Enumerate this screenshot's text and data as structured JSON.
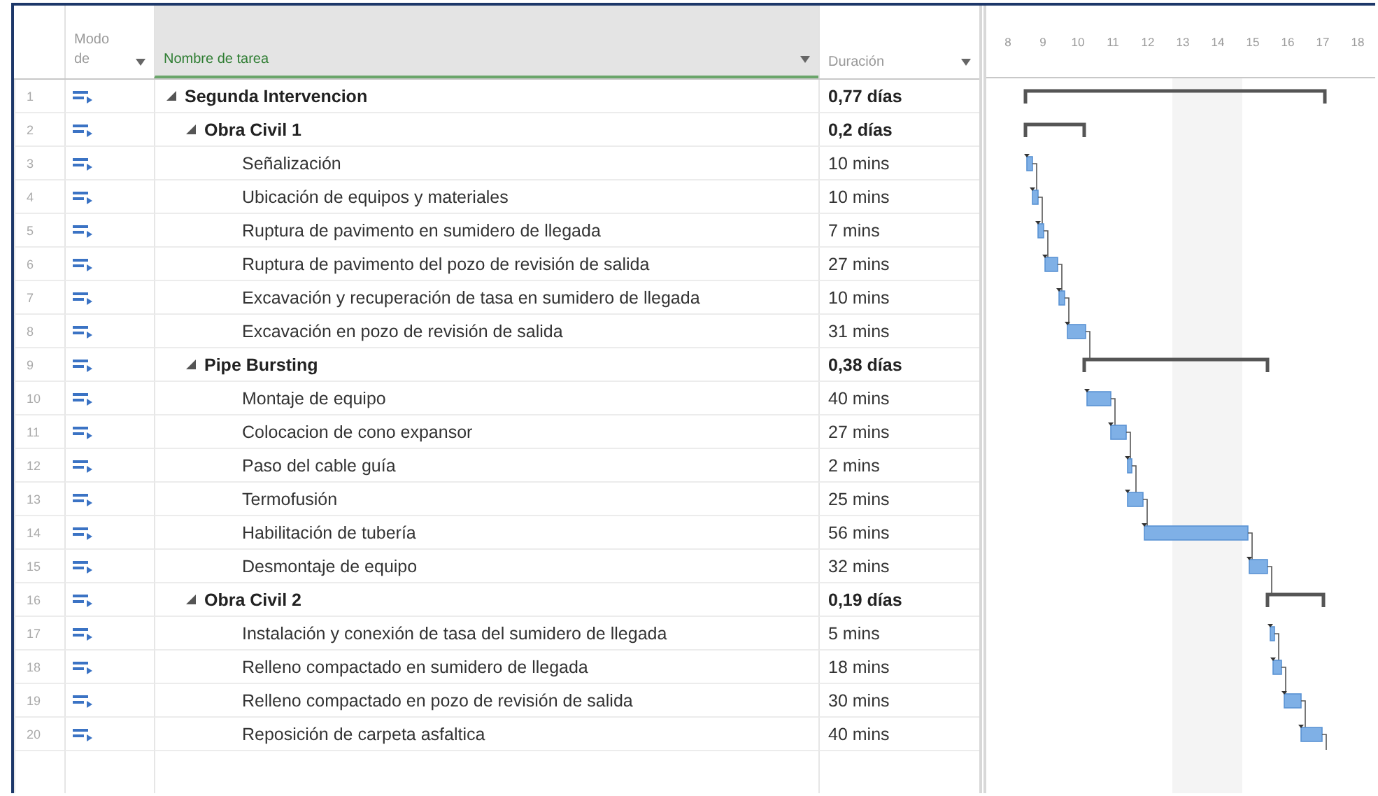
{
  "columns": [
    {
      "label": "Modo de",
      "selected": false
    },
    {
      "label": "Nombre de tarea",
      "selected": true
    },
    {
      "label": "Duración",
      "selected": false
    }
  ],
  "timescale": [
    "8",
    "9",
    "10",
    "11",
    "12",
    "13",
    "14",
    "15",
    "16",
    "17",
    "18"
  ],
  "tasks": [
    {
      "id": "1",
      "name": "Segunda Intervencion",
      "duration": "0,77 días",
      "expanded": true,
      "children": [
        {
          "id": "2",
          "name": "Obra Civil 1",
          "duration": "0,2 días",
          "expanded": true,
          "children": [
            {
              "id": "3",
              "name": "Señalización",
              "duration": "10 mins"
            },
            {
              "id": "4",
              "name": "Ubicación de equipos y materiales",
              "duration": "10 mins"
            },
            {
              "id": "5",
              "name": "Ruptura de pavimento en sumidero de llegada",
              "duration": "7 mins"
            },
            {
              "id": "6",
              "name": "Ruptura de pavimento del pozo de revisión de salida",
              "duration": "27 mins"
            },
            {
              "id": "7",
              "name": "Excavación y recuperación de tasa en sumidero de llegada",
              "duration": "10 mins"
            },
            {
              "id": "8",
              "name": "Excavación en pozo de revisión de salida",
              "duration": "31 mins"
            }
          ]
        },
        {
          "id": "9",
          "name": "Pipe Bursting",
          "duration": "0,38 días",
          "expanded": true,
          "children": [
            {
              "id": "10",
              "name": "Montaje de equipo",
              "duration": "40 mins"
            },
            {
              "id": "11",
              "name": "Colocacion de cono expansor",
              "duration": "27 mins"
            },
            {
              "id": "12",
              "name": "Paso del cable guía",
              "duration": "2 mins"
            },
            {
              "id": "13",
              "name": "Termofusión",
              "duration": "25 mins"
            },
            {
              "id": "14",
              "name": "Habilitación de tubería",
              "duration": "56 mins"
            },
            {
              "id": "15",
              "name": "Desmontaje de equipo",
              "duration": "32 mins"
            }
          ]
        },
        {
          "id": "16",
          "name": "Obra Civil 2",
          "duration": "0,19 días",
          "expanded": true,
          "children": [
            {
              "id": "17",
              "name": "Instalación y conexión de tasa del sumidero de llegada",
              "duration": "5 mins"
            },
            {
              "id": "18",
              "name": "Relleno compactado en sumidero de llegada",
              "duration": "18 mins"
            },
            {
              "id": "19",
              "name": "Relleno compactado en pozo de revisión de salida",
              "duration": "30 mins"
            },
            {
              "id": "20",
              "name": "Reposición de carpeta asfaltica",
              "duration": "40 mins"
            }
          ]
        }
      ]
    }
  ]
}
